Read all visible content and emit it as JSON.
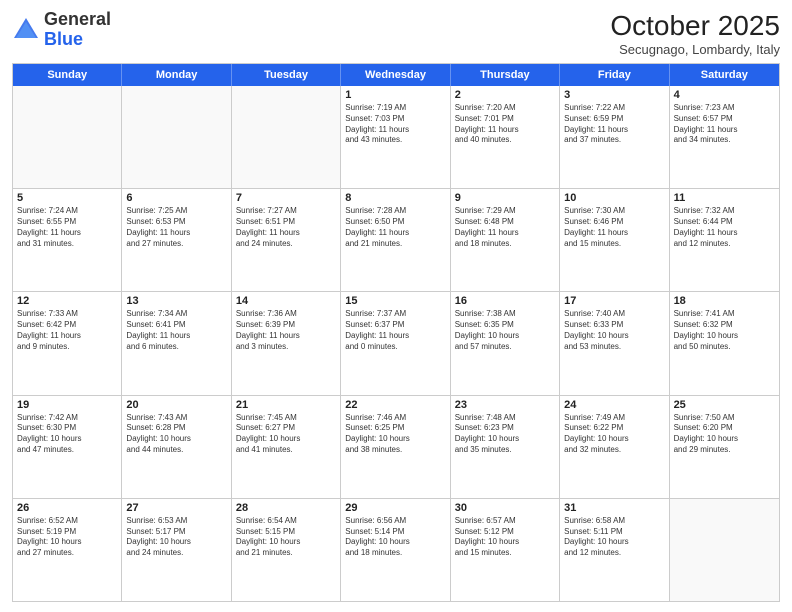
{
  "header": {
    "logo_general": "General",
    "logo_blue": "Blue",
    "month_title": "October 2025",
    "subtitle": "Secugnago, Lombardy, Italy"
  },
  "days_of_week": [
    "Sunday",
    "Monday",
    "Tuesday",
    "Wednesday",
    "Thursday",
    "Friday",
    "Saturday"
  ],
  "rows": [
    {
      "cells": [
        {
          "empty": true
        },
        {
          "empty": true
        },
        {
          "empty": true
        },
        {
          "day": "1",
          "text": "Sunrise: 7:19 AM\nSunset: 7:03 PM\nDaylight: 11 hours\nand 43 minutes."
        },
        {
          "day": "2",
          "text": "Sunrise: 7:20 AM\nSunset: 7:01 PM\nDaylight: 11 hours\nand 40 minutes."
        },
        {
          "day": "3",
          "text": "Sunrise: 7:22 AM\nSunset: 6:59 PM\nDaylight: 11 hours\nand 37 minutes."
        },
        {
          "day": "4",
          "text": "Sunrise: 7:23 AM\nSunset: 6:57 PM\nDaylight: 11 hours\nand 34 minutes."
        }
      ]
    },
    {
      "cells": [
        {
          "day": "5",
          "text": "Sunrise: 7:24 AM\nSunset: 6:55 PM\nDaylight: 11 hours\nand 31 minutes."
        },
        {
          "day": "6",
          "text": "Sunrise: 7:25 AM\nSunset: 6:53 PM\nDaylight: 11 hours\nand 27 minutes."
        },
        {
          "day": "7",
          "text": "Sunrise: 7:27 AM\nSunset: 6:51 PM\nDaylight: 11 hours\nand 24 minutes."
        },
        {
          "day": "8",
          "text": "Sunrise: 7:28 AM\nSunset: 6:50 PM\nDaylight: 11 hours\nand 21 minutes."
        },
        {
          "day": "9",
          "text": "Sunrise: 7:29 AM\nSunset: 6:48 PM\nDaylight: 11 hours\nand 18 minutes."
        },
        {
          "day": "10",
          "text": "Sunrise: 7:30 AM\nSunset: 6:46 PM\nDaylight: 11 hours\nand 15 minutes."
        },
        {
          "day": "11",
          "text": "Sunrise: 7:32 AM\nSunset: 6:44 PM\nDaylight: 11 hours\nand 12 minutes."
        }
      ]
    },
    {
      "cells": [
        {
          "day": "12",
          "text": "Sunrise: 7:33 AM\nSunset: 6:42 PM\nDaylight: 11 hours\nand 9 minutes."
        },
        {
          "day": "13",
          "text": "Sunrise: 7:34 AM\nSunset: 6:41 PM\nDaylight: 11 hours\nand 6 minutes."
        },
        {
          "day": "14",
          "text": "Sunrise: 7:36 AM\nSunset: 6:39 PM\nDaylight: 11 hours\nand 3 minutes."
        },
        {
          "day": "15",
          "text": "Sunrise: 7:37 AM\nSunset: 6:37 PM\nDaylight: 11 hours\nand 0 minutes."
        },
        {
          "day": "16",
          "text": "Sunrise: 7:38 AM\nSunset: 6:35 PM\nDaylight: 10 hours\nand 57 minutes."
        },
        {
          "day": "17",
          "text": "Sunrise: 7:40 AM\nSunset: 6:33 PM\nDaylight: 10 hours\nand 53 minutes."
        },
        {
          "day": "18",
          "text": "Sunrise: 7:41 AM\nSunset: 6:32 PM\nDaylight: 10 hours\nand 50 minutes."
        }
      ]
    },
    {
      "cells": [
        {
          "day": "19",
          "text": "Sunrise: 7:42 AM\nSunset: 6:30 PM\nDaylight: 10 hours\nand 47 minutes."
        },
        {
          "day": "20",
          "text": "Sunrise: 7:43 AM\nSunset: 6:28 PM\nDaylight: 10 hours\nand 44 minutes."
        },
        {
          "day": "21",
          "text": "Sunrise: 7:45 AM\nSunset: 6:27 PM\nDaylight: 10 hours\nand 41 minutes."
        },
        {
          "day": "22",
          "text": "Sunrise: 7:46 AM\nSunset: 6:25 PM\nDaylight: 10 hours\nand 38 minutes."
        },
        {
          "day": "23",
          "text": "Sunrise: 7:48 AM\nSunset: 6:23 PM\nDaylight: 10 hours\nand 35 minutes."
        },
        {
          "day": "24",
          "text": "Sunrise: 7:49 AM\nSunset: 6:22 PM\nDaylight: 10 hours\nand 32 minutes."
        },
        {
          "day": "25",
          "text": "Sunrise: 7:50 AM\nSunset: 6:20 PM\nDaylight: 10 hours\nand 29 minutes."
        }
      ]
    },
    {
      "cells": [
        {
          "day": "26",
          "text": "Sunrise: 6:52 AM\nSunset: 5:19 PM\nDaylight: 10 hours\nand 27 minutes."
        },
        {
          "day": "27",
          "text": "Sunrise: 6:53 AM\nSunset: 5:17 PM\nDaylight: 10 hours\nand 24 minutes."
        },
        {
          "day": "28",
          "text": "Sunrise: 6:54 AM\nSunset: 5:15 PM\nDaylight: 10 hours\nand 21 minutes."
        },
        {
          "day": "29",
          "text": "Sunrise: 6:56 AM\nSunset: 5:14 PM\nDaylight: 10 hours\nand 18 minutes."
        },
        {
          "day": "30",
          "text": "Sunrise: 6:57 AM\nSunset: 5:12 PM\nDaylight: 10 hours\nand 15 minutes."
        },
        {
          "day": "31",
          "text": "Sunrise: 6:58 AM\nSunset: 5:11 PM\nDaylight: 10 hours\nand 12 minutes."
        },
        {
          "empty": true
        }
      ]
    }
  ]
}
